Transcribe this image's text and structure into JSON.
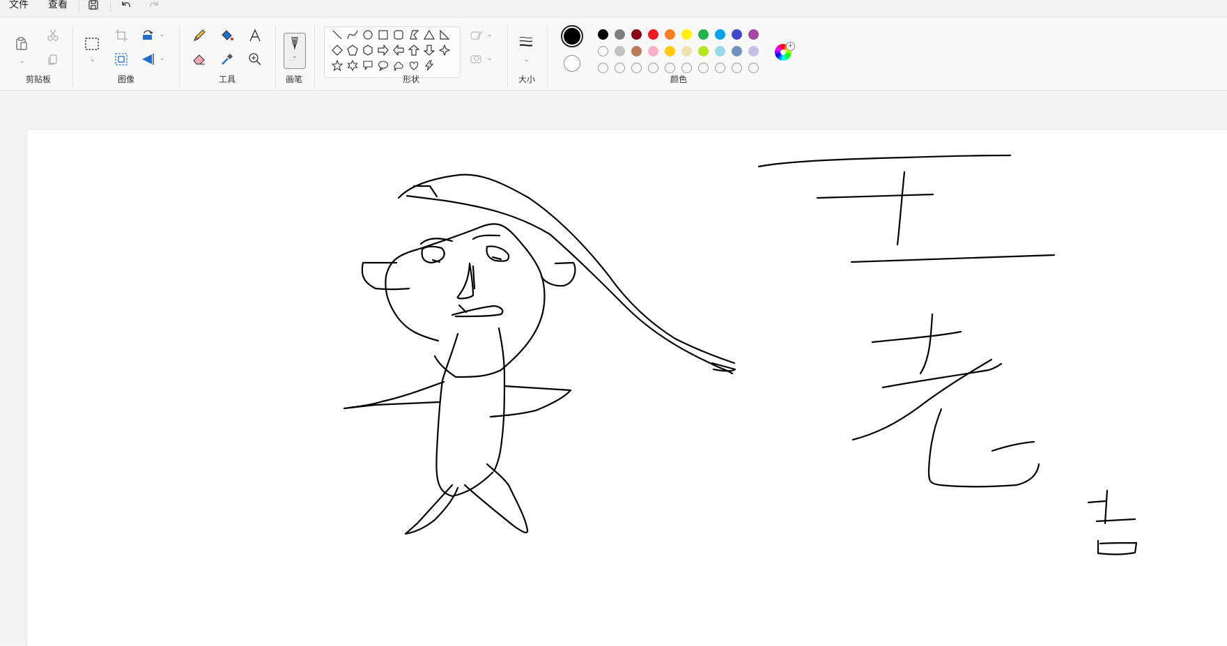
{
  "menu": {
    "file": "文件",
    "view": "查看"
  },
  "ribbon": {
    "groups": {
      "clipboard": "剪贴板",
      "image": "图像",
      "tools": "工具",
      "brushes": "画笔",
      "shapes": "形状",
      "size": "大小",
      "colors": "颜色"
    }
  },
  "colors": {
    "primary": "#000000",
    "secondary": "#ffffff",
    "palette_row1": [
      "#000000",
      "#7f7f7f",
      "#880015",
      "#ed1c24",
      "#ff7f27",
      "#fff200",
      "#22b14c",
      "#00a2e8",
      "#3f48cc",
      "#a349a4"
    ],
    "palette_row2": [
      "#ffffff",
      "#c3c3c3",
      "#b97a57",
      "#ffaec9",
      "#ffc90e",
      "#efe4b0",
      "#b5e61d",
      "#99d9ea",
      "#7092be",
      "#c8bfe7"
    ],
    "palette_row3_empty_count": 10
  },
  "icons": {
    "save": "save-icon",
    "undo": "undo-icon",
    "redo": "redo-icon",
    "paste": "paste-icon",
    "cut": "cut-icon",
    "copy": "copy-icon",
    "select": "select-icon",
    "crop": "crop-icon",
    "rotate": "rotate-icon",
    "resize": "resize-icon",
    "flip": "flip-icon",
    "pencil": "pencil-icon",
    "fill": "fill-bucket-icon",
    "text": "text-icon",
    "eraser": "eraser-icon",
    "picker": "color-picker-icon",
    "magnifier": "magnifier-icon",
    "brush": "brush-icon",
    "outline": "shape-outline-icon",
    "shape_fill": "shape-fill-icon",
    "size": "size-icon",
    "edit_colors": "edit-colors-icon"
  }
}
